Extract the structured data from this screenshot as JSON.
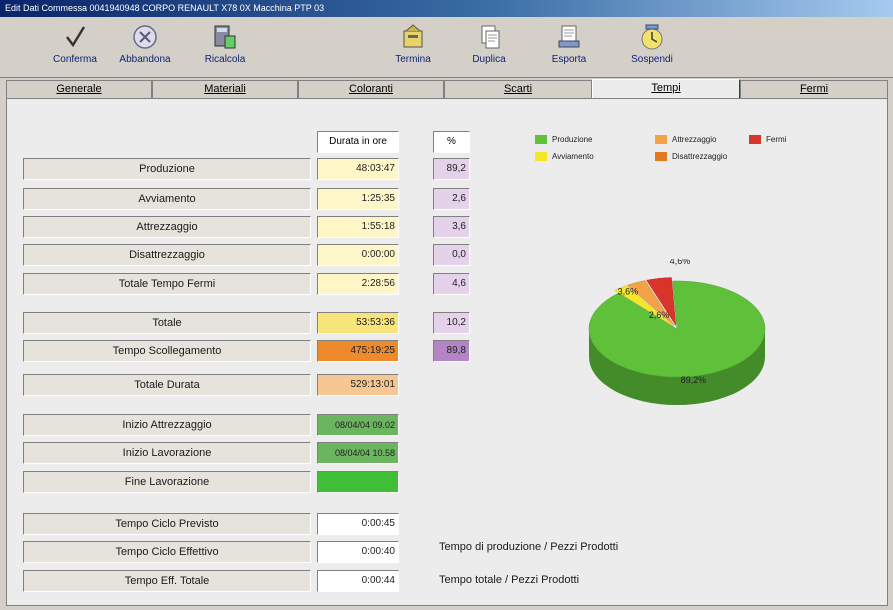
{
  "window": {
    "title": "Edit Dati Commessa    0041940948 CORPO RENAULT X78 0X    Macchina PTP 03"
  },
  "toolbar": {
    "buttons": [
      {
        "label": "Conferma",
        "icon": "checkmark-icon"
      },
      {
        "label": "Abbandona",
        "icon": "cancel-icon"
      },
      {
        "label": "Ricalcola",
        "icon": "recalculate-icon"
      },
      {
        "label": "Termina",
        "icon": "terminate-icon"
      },
      {
        "label": "Duplica",
        "icon": "duplicate-icon"
      },
      {
        "label": "Esporta",
        "icon": "export-icon"
      },
      {
        "label": "Sospendi",
        "icon": "suspend-icon"
      }
    ]
  },
  "tabs": [
    {
      "label": "Generale"
    },
    {
      "label": "Materiali"
    },
    {
      "label": "Coloranti"
    },
    {
      "label": "Scarti"
    },
    {
      "label": "Tempi"
    },
    {
      "label": "Fermi"
    }
  ],
  "active_tab": "Tempi",
  "table": {
    "col_durata": "Durata in ore",
    "col_percent": "%",
    "rows": [
      {
        "label": "Produzione",
        "durata": "48:03:47",
        "percent": "89,2"
      },
      {
        "label": "Avviamento",
        "durata": "1:25:35",
        "percent": "2,6"
      },
      {
        "label": "Attrezzaggio",
        "durata": "1:55:18",
        "percent": "3,6"
      },
      {
        "label": "Disattrezzaggio",
        "durata": "0:00:00",
        "percent": "0,0"
      },
      {
        "label": "Totale Tempo Fermi",
        "durata": "2:28:56",
        "percent": "4,6"
      }
    ],
    "totale": {
      "label": "Totale",
      "durata": "53:53:36",
      "percent": "10,2"
    },
    "scollegamento": {
      "label": "Tempo Scollegamento",
      "durata": "475:19:25",
      "percent": "89,8"
    },
    "totale_durata": {
      "label": "Totale Durata",
      "durata": "529:13:01"
    },
    "inizio_attrezzaggio": {
      "label": "Inizio Attrezzaggio",
      "value": "08/04/04 09.02"
    },
    "inizio_lavorazione": {
      "label": "Inizio Lavorazione",
      "value": "08/04/04 10.58"
    },
    "fine_lavorazione": {
      "label": "Fine Lavorazione",
      "value": ""
    },
    "ciclo_previsto": {
      "label": "Tempo Ciclo Previsto",
      "value": "0:00:45"
    },
    "ciclo_effettivo": {
      "label": "Tempo Ciclo Effettivo",
      "value": "0:00:40",
      "note": "Tempo di produzione / Pezzi Prodotti"
    },
    "eff_totale": {
      "label": "Tempo Eff. Totale",
      "value": "0:00:44",
      "note": "Tempo totale / Pezzi Prodotti"
    }
  },
  "colors": {
    "produzione": "#5fc13a",
    "avviamento": "#f5e62a",
    "attrezzaggio": "#f2a347",
    "disattrezzaggio": "#e07a1c",
    "fermi": "#d9342a",
    "cell_light_yellow": "#fff6c8",
    "cell_lavender": "#e4d2ea",
    "cell_yellow": "#f7e47a",
    "cell_orange": "#ec8a2c",
    "cell_purple": "#b485c4",
    "cell_peach": "#f6c792",
    "cell_green": "#6cb560",
    "cell_bright_green": "#3fbf35"
  },
  "chart_data": {
    "type": "pie",
    "legend": [
      "Produzione",
      "Attrezzaggio",
      "Fermi",
      "Avviamento",
      "Disattrezzaggio"
    ],
    "legend_placement": "top",
    "series": [
      {
        "name": "Produzione",
        "value": 89.2,
        "label": "89,2%"
      },
      {
        "name": "Avviamento",
        "value": 2.6,
        "label": "2,6%"
      },
      {
        "name": "Attrezzaggio",
        "value": 3.6,
        "label": "3,6%"
      },
      {
        "name": "Disattrezzaggio",
        "value": 0.0,
        "label": ""
      },
      {
        "name": "Fermi",
        "value": 4.6,
        "label": "4,6%"
      }
    ]
  }
}
